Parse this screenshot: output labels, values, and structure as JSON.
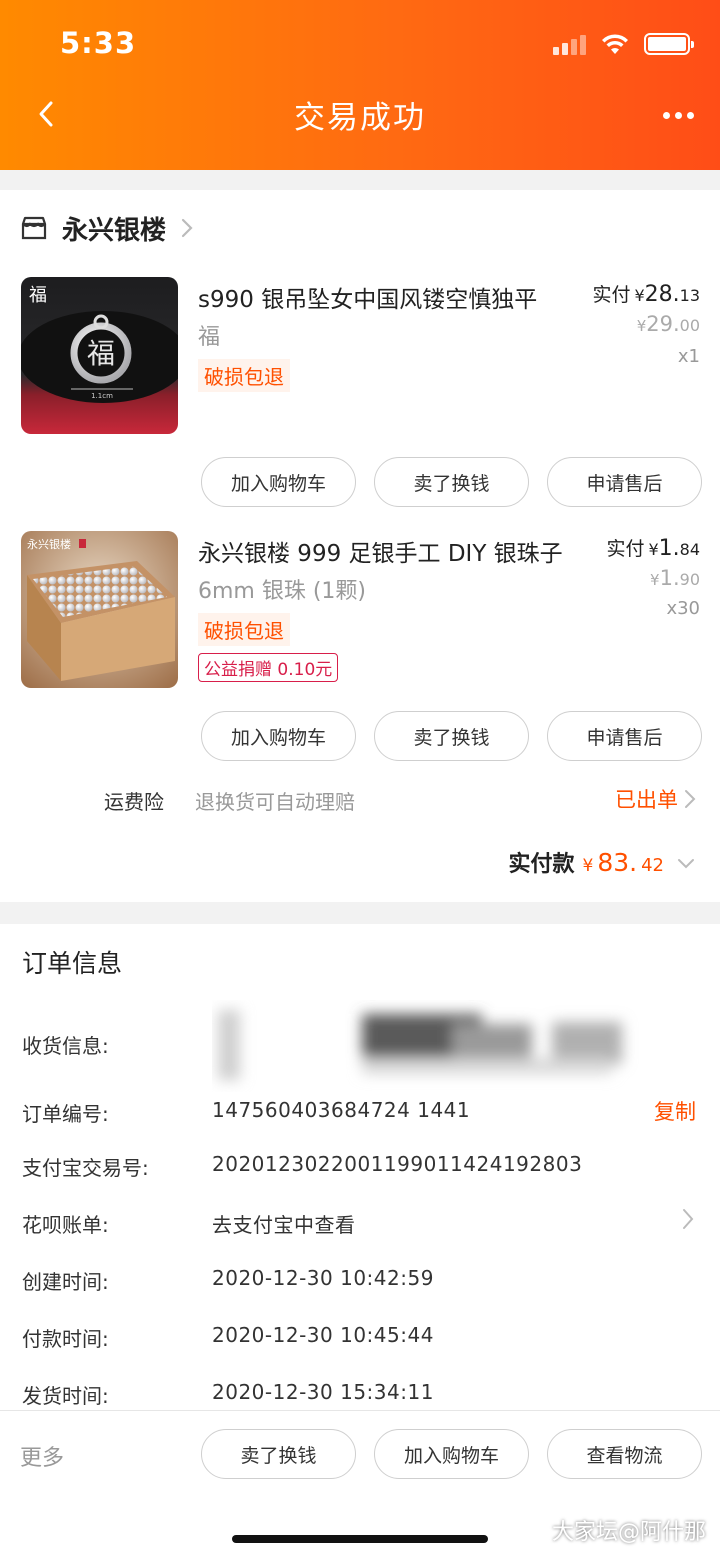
{
  "status_bar": {
    "time": "5:33"
  },
  "header": {
    "title": "交易成功"
  },
  "store": {
    "name": "永兴银楼"
  },
  "items": [
    {
      "title": "s990 银吊坠女中国风镂空慎独平",
      "spec": "福",
      "tag": "破损包退",
      "paid_label": "实付",
      "currency": "¥",
      "paid_int": "28.",
      "paid_dec": "13",
      "orig_int": "29.",
      "orig_dec": "00",
      "qty": "x1",
      "image_caption": "福",
      "image_ruler": "1.1cm"
    },
    {
      "title": "永兴银楼 999 足银手工 DIY 银珠子",
      "spec": "6mm 银珠 (1颗)",
      "tag": "破损包退",
      "charity": "公益捐赠 0.10元",
      "paid_label": "实付",
      "currency": "¥",
      "paid_int": "1.",
      "paid_dec": "84",
      "orig_int": "1.",
      "orig_dec": "90",
      "qty": "x30",
      "image_caption": "永兴银楼"
    }
  ],
  "buttons": {
    "add_to_cart": "加入购物车",
    "sell": "卖了换钱",
    "after_sale": "申请售后",
    "logistics": "查看物流",
    "copy": "复制",
    "more": "更多"
  },
  "insurance": {
    "label": "运费险",
    "desc": "退换货可自动理赔",
    "status": "已出单"
  },
  "total": {
    "label": "实付款",
    "currency": "¥",
    "int": "83.",
    "dec": "42"
  },
  "order_info": {
    "title": "订单信息",
    "address_label": "收货信息:",
    "order_no_label": "订单编号:",
    "order_no": "147560403684724 1441",
    "alipay_label": "支付宝交易号:",
    "alipay_no": "2020123022001199011424192803",
    "huabei_label": "花呗账单:",
    "huabei_value": "去支付宝中查看",
    "created_label": "创建时间:",
    "created": "2020-12-30 10:42:59",
    "paid_label": "付款时间:",
    "paid": "2020-12-30 10:45:44",
    "shipped_label": "发货时间:",
    "shipped": "2020-12-30 15:34:11"
  },
  "watermark": "大家坛@阿什那",
  "colors": {
    "accent": "#ff5000",
    "header_start": "#ff8a00",
    "header_end": "#ff4d17"
  }
}
